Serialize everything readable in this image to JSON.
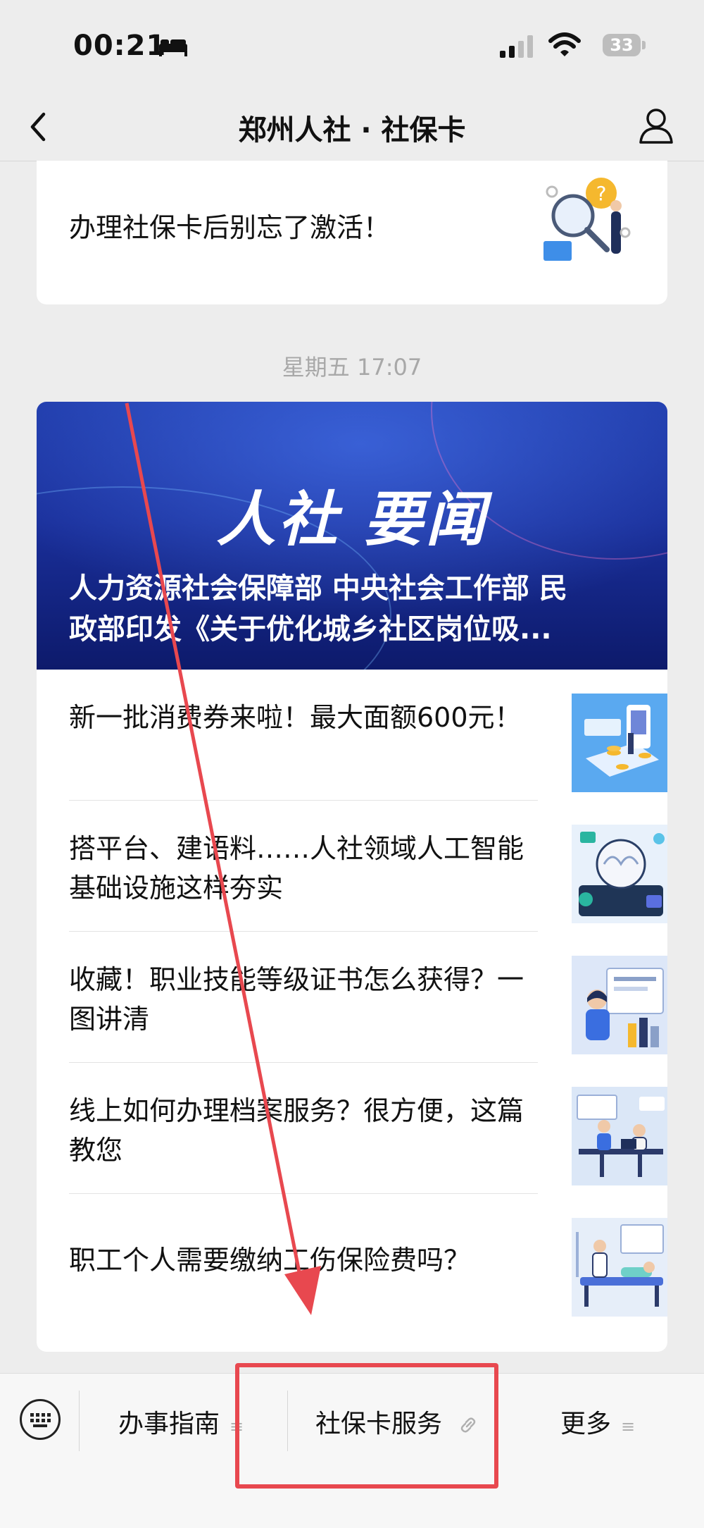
{
  "status_bar": {
    "time": "00:21",
    "battery": "33"
  },
  "nav": {
    "title": "郑州人社 · 社保卡"
  },
  "card_top": {
    "title": "办理社保卡后别忘了激活！"
  },
  "timestamp": "星期五 17:07",
  "banner": {
    "heading": "人社 要闻",
    "headline": "人力资源社会保障部 中央社会工作部 民\n政部印发《关于优化城乡社区岗位吸..."
  },
  "articles": [
    {
      "title": "新一批消费券来啦！最大面额600元！"
    },
    {
      "title": "搭平台、建语料……人社领域人工智能基础设施这样夯实"
    },
    {
      "title": "收藏！职业技能等级证书怎么获得？一图讲清"
    },
    {
      "title": "线上如何办理档案服务？很方便，这篇教您"
    },
    {
      "title": "职工个人需要缴纳工伤保险费吗？"
    }
  ],
  "menu": {
    "item1": "办事指南",
    "item1_icon": "≡",
    "item2": "社保卡服务",
    "item2_icon": "link-icon",
    "item3": "更多",
    "item3_icon": "≡"
  },
  "annotation_color": "#e8484f"
}
